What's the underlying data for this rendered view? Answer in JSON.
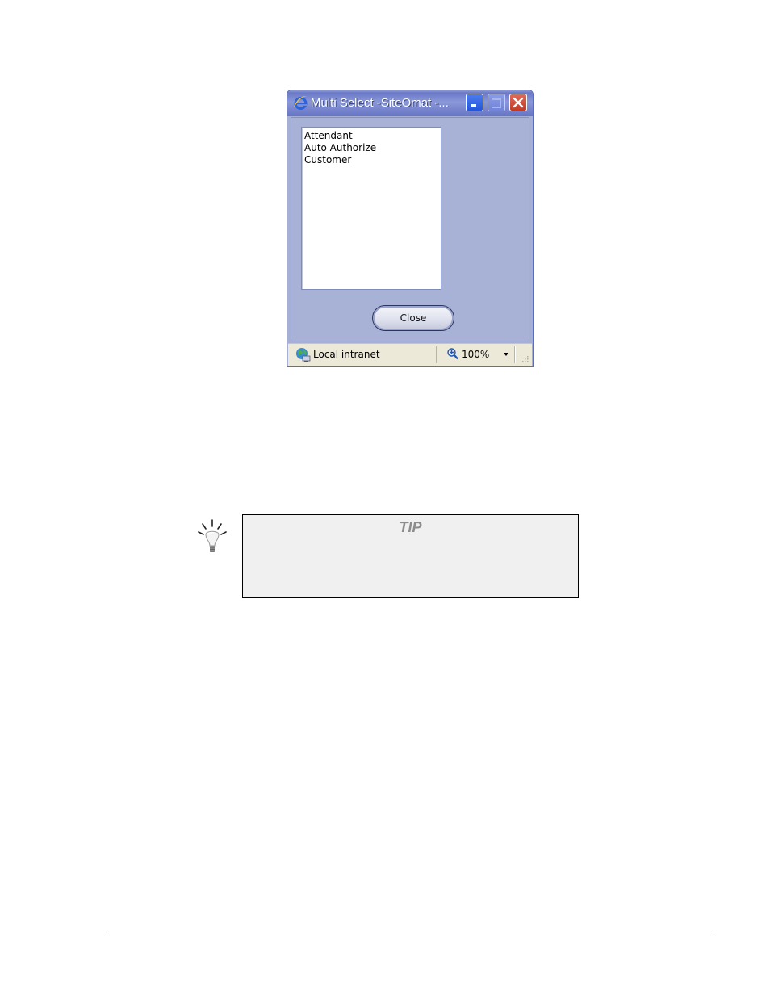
{
  "window": {
    "title": "Multi Select -SiteOmat -...",
    "controls": {
      "minimize_icon": "minimize-icon",
      "maximize_icon": "maximize-icon",
      "close_icon": "close-icon"
    }
  },
  "listbox": {
    "items": [
      "Attendant",
      "Auto Authorize",
      "Customer"
    ]
  },
  "close_button": {
    "label": "Close"
  },
  "statusbar": {
    "zone": "Local intranet",
    "zoom": "100%"
  },
  "tip": {
    "title": "TIP",
    "icon": "lightbulb-icon"
  },
  "colors": {
    "titlebar": "#7a87cf",
    "window_body": "#a8b2d6",
    "statusbar": "#ece9d8",
    "close_red": "#c23a24",
    "tip_background": "#f0f0f0"
  }
}
